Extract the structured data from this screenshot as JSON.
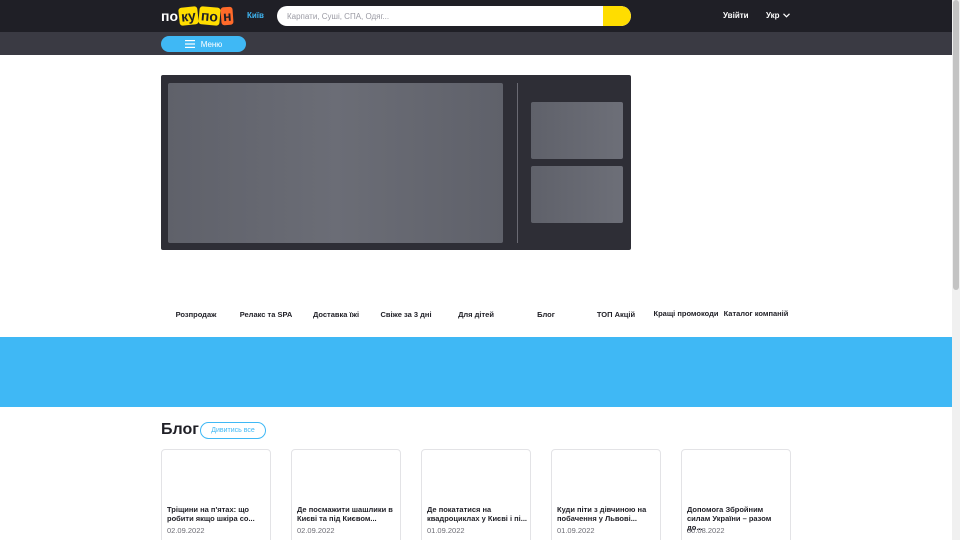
{
  "header": {
    "logo_text": [
      "по",
      "ку",
      "по",
      "н"
    ],
    "city": "Київ",
    "search_placeholder": "Карпати, Суші, СПА, Одяг...",
    "login": "Увійти",
    "language": "Укр"
  },
  "subheader": {
    "menu_label": "Меню"
  },
  "categories": [
    "Розпродаж",
    "Релакс та SPA",
    "Доставка їжі",
    "Свіже за 3 дні",
    "Для дітей",
    "Блог",
    "ТОП Акцій",
    "Кращі промокоди",
    "Каталог компаній"
  ],
  "blog": {
    "title": "Блог",
    "view_all": "Дивитись все",
    "posts": [
      {
        "title": "Тріщини на п'ятах: що робити якщо шкіра со...",
        "date": "02.09.2022"
      },
      {
        "title": "Де посмажити шашлики в Києві та під Києвом...",
        "date": "02.09.2022"
      },
      {
        "title": "Де покататися на квадроциклах у Києві і пі...",
        "date": "01.09.2022"
      },
      {
        "title": "Куди піти з дівчиною на побачення у Львові...",
        "date": "01.09.2022"
      },
      {
        "title": "Допомога Збройним силам України – разом до...",
        "date": "30.08.2022"
      }
    ]
  },
  "colors": {
    "header_bg": "#1f1f26",
    "accent_blue": "#3fb8f5",
    "accent_yellow": "#ffdd00"
  }
}
